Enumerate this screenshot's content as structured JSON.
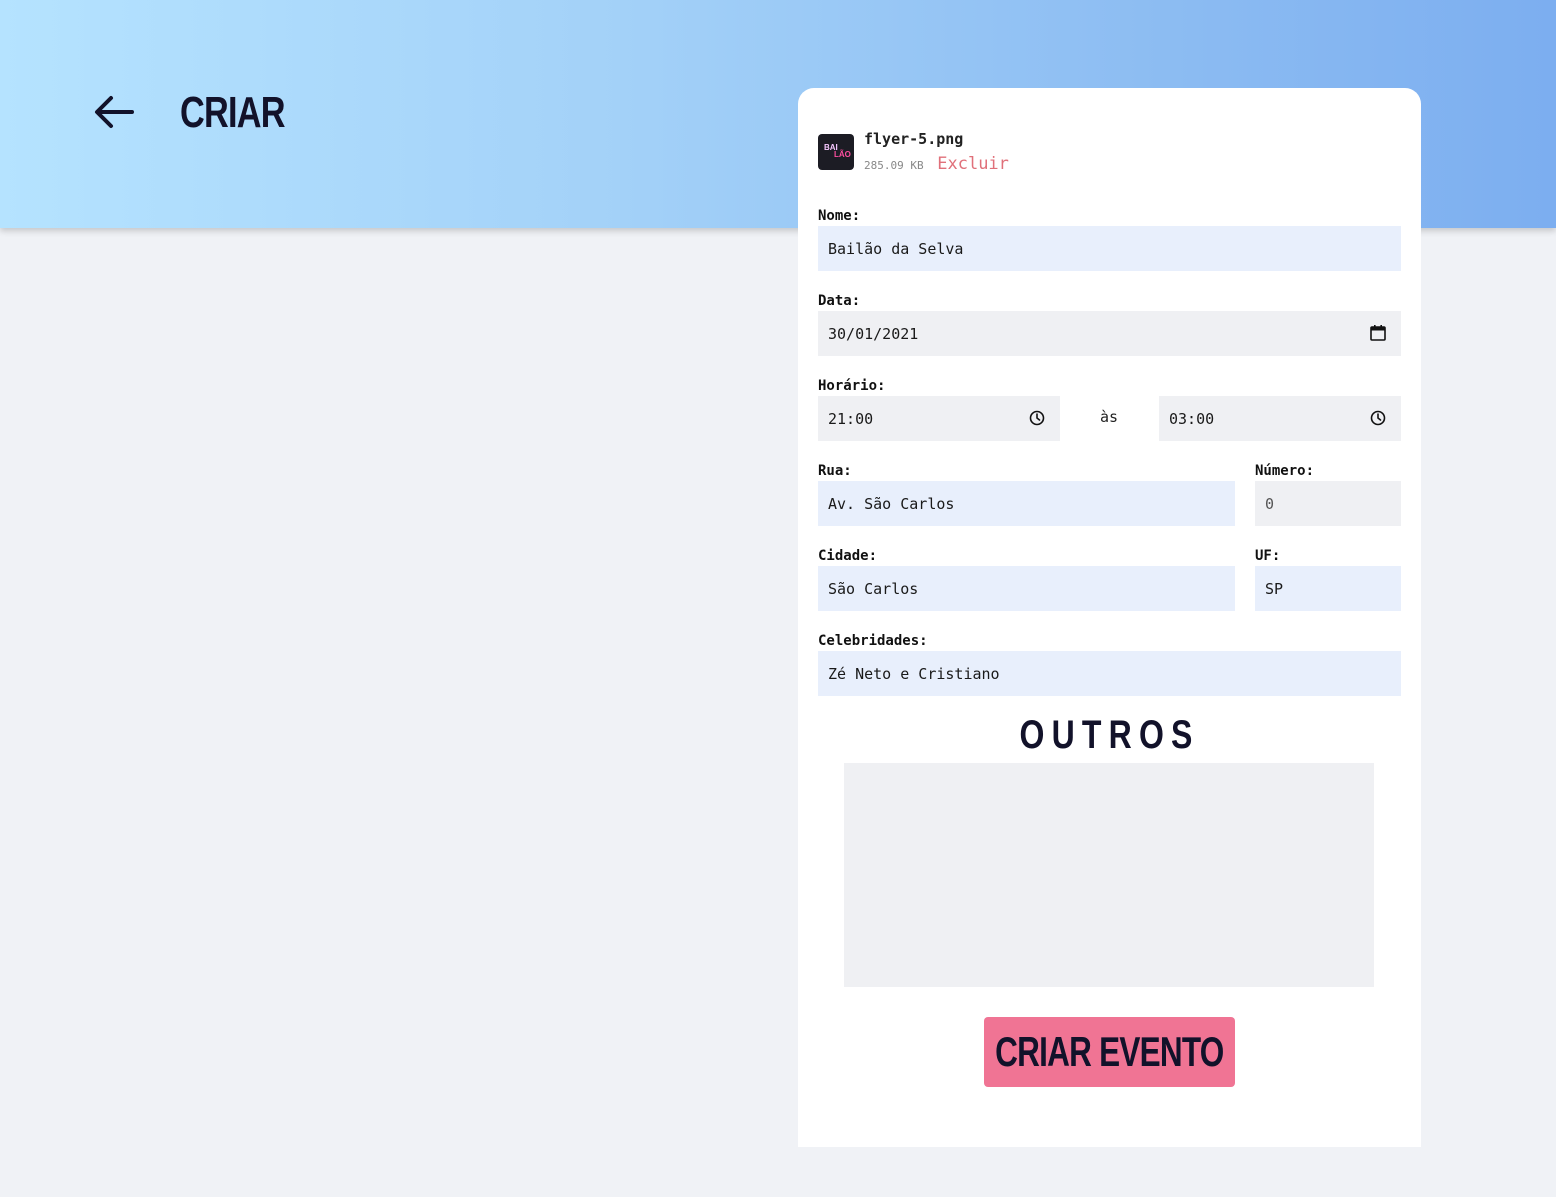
{
  "header": {
    "title": "CRIAR",
    "back_icon": "arrow-left-icon"
  },
  "file": {
    "name": "flyer-5.png",
    "size": "285.09 KB",
    "delete_label": "Excluir",
    "thumb_text_top": "BAI",
    "thumb_text_bottom": "LÃO"
  },
  "form": {
    "nome": {
      "label": "Nome:",
      "value": "Bailão da Selva"
    },
    "data": {
      "label": "Data:",
      "value": "30/01/2021",
      "icon": "calendar-icon"
    },
    "horario": {
      "label": "Horário:",
      "start": "21:00",
      "separator": "às",
      "end": "03:00",
      "icon": "clock-icon"
    },
    "rua": {
      "label": "Rua:",
      "value": "Av. São Carlos"
    },
    "numero": {
      "label": "Número:",
      "value": "0"
    },
    "cidade": {
      "label": "Cidade:",
      "value": "São Carlos"
    },
    "uf": {
      "label": "UF:",
      "value": "SP"
    },
    "celebridades": {
      "label": "Celebridades:",
      "value": "Zé Neto e Cristiano"
    },
    "outros": {
      "heading": "OUTROS",
      "value": ""
    },
    "submit_label": "CRIAR EVENTO"
  },
  "colors": {
    "header_gradient_start": "#b5e3ff",
    "header_gradient_end": "#7caef0",
    "submit_bg": "#f07494",
    "delete_text": "#e0707a",
    "input_blue": "#e8effc",
    "input_gray": "#eff0f3"
  }
}
